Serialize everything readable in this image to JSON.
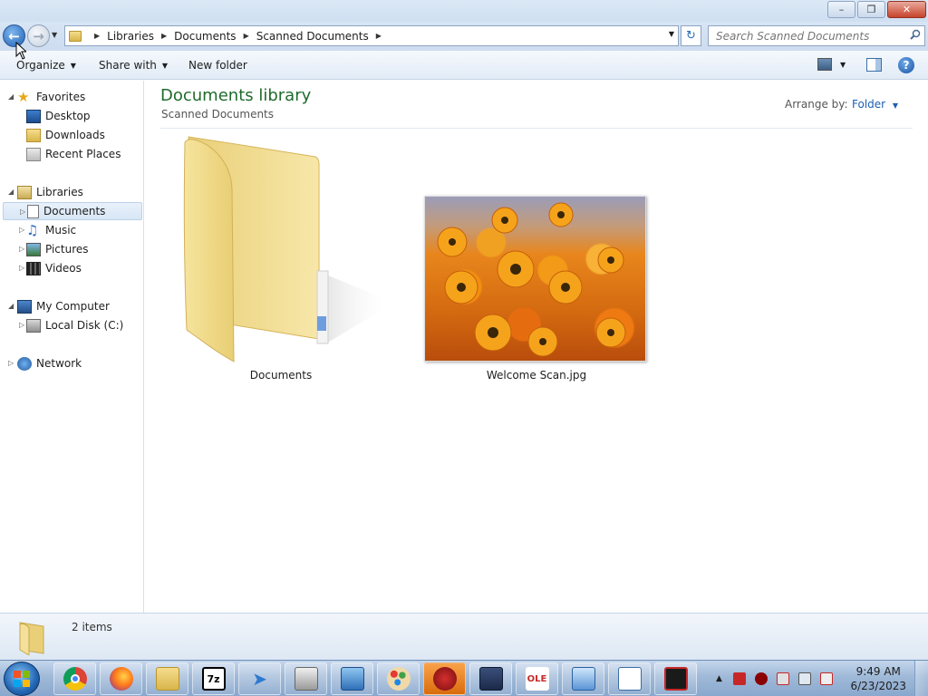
{
  "window": {
    "minimize_label": "–",
    "restore_label": "❐",
    "close_label": "✕"
  },
  "address": {
    "crumbs": [
      "Libraries",
      "Documents",
      "Scanned Documents"
    ],
    "search_placeholder": "Search Scanned Documents"
  },
  "toolbar": {
    "organize_label": "Organize",
    "share_label": "Share with",
    "new_folder_label": "New folder",
    "help_label": "?"
  },
  "nav": {
    "favorites": {
      "label": "Favorites",
      "items": [
        "Desktop",
        "Downloads",
        "Recent Places"
      ]
    },
    "libraries": {
      "label": "Libraries",
      "items": [
        "Documents",
        "Music",
        "Pictures",
        "Videos"
      ]
    },
    "computer": {
      "label": "My Computer",
      "items": [
        "Local Disk (C:)"
      ]
    },
    "network": {
      "label": "Network"
    }
  },
  "content": {
    "title": "Documents library",
    "subtitle": "Scanned Documents",
    "arrange_label": "Arrange by:",
    "arrange_value": "Folder",
    "files": [
      {
        "name": "Documents",
        "type": "folder"
      },
      {
        "name": "Welcome Scan.jpg",
        "type": "image"
      }
    ]
  },
  "status": {
    "text": "2 items"
  },
  "taskbar": {
    "apps": [
      "chrome-icon",
      "firefox-icon",
      "file-explorer-icon",
      "7zip-icon",
      "paper-plane-icon",
      "printer-icon",
      "control-panel-icon",
      "paint-icon",
      "security-icon",
      "scan-icon",
      "ole-viewer-icon",
      "remote-desktop-icon",
      "form-editor-icon",
      "screen-recorder-icon"
    ],
    "sevenzip_label": "7z",
    "ole_label": "OLE",
    "time": "9:49 AM",
    "date": "6/23/2023"
  },
  "colors": {
    "library_title": "#1f6b2c",
    "link": "#1d5fb3",
    "selection": "#d8e6f5"
  }
}
